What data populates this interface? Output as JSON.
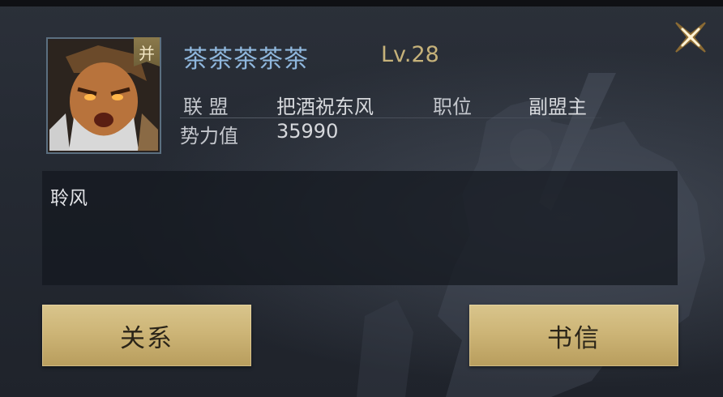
{
  "player": {
    "name": "茶茶茶茶茶",
    "level": "Lv.28",
    "faction_badge": "并"
  },
  "info": {
    "alliance_label": "联  盟",
    "alliance_value": "把酒祝东风",
    "position_label": "职位",
    "position_value": "副盟主",
    "power_label": "势力值",
    "power_value": "35990"
  },
  "message": {
    "text": "聆风"
  },
  "buttons": {
    "relations": "关系",
    "letter": "书信"
  },
  "colors": {
    "name": "#8fb7dd",
    "level": "#c6b27a",
    "button_gold": "#cdb577",
    "panel_bg": "#252a33"
  },
  "icons": {
    "close": "close-x-icon",
    "avatar": "general-portrait"
  }
}
